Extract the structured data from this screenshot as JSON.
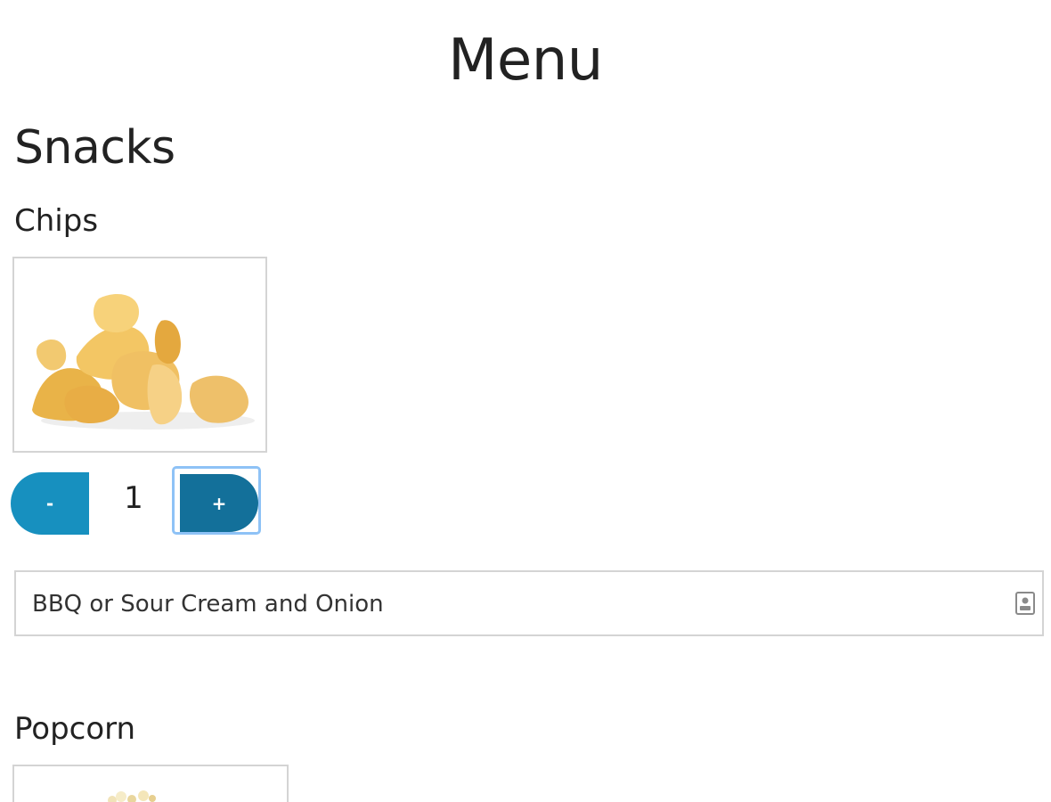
{
  "page": {
    "title": "Menu"
  },
  "section": {
    "title": "Snacks"
  },
  "items": [
    {
      "title": "Chips",
      "image_alt": "chips-image",
      "quantity": "1",
      "minus_label": "-",
      "plus_label": "+",
      "notes_value": "BBQ or Sour Cream and Onion"
    },
    {
      "title": "Popcorn",
      "image_alt": "popcorn-image"
    }
  ],
  "colors": {
    "minus_button": "#1790bf",
    "plus_button": "#13709a",
    "focus_ring": "#8ec2f6"
  },
  "icons": {
    "notes_field_icon": "contact-card-icon"
  }
}
